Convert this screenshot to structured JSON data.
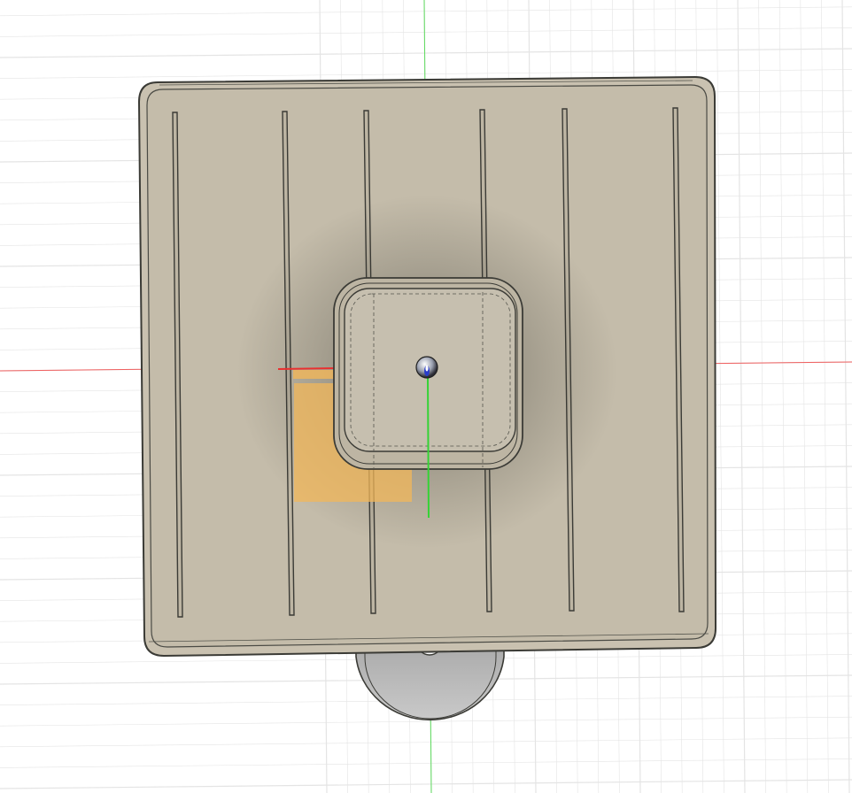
{
  "app": {
    "type": "cad-3d-viewport",
    "view": "top"
  },
  "colors": {
    "background": "#ffffff",
    "grid": "#e4e4e4",
    "axis_x": "#f06060",
    "axis_y": "#5fdc5f",
    "body_fill": "#c7bfae",
    "body_edge": "#3b3b36",
    "highlight": "#f1b75a",
    "origin": "#2a3dc9"
  },
  "icons": {
    "origin_marker": "origin-point-icon"
  },
  "model": {
    "rib_count": 6,
    "has_center_boss": true,
    "has_bottom_tab": true
  }
}
